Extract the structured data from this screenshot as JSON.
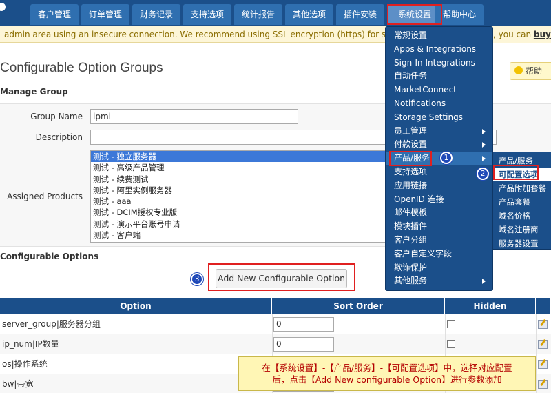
{
  "nav": {
    "tabs": [
      "客户管理",
      "订单管理",
      "财务记录",
      "支持选项",
      "统计报告",
      "其他选项",
      "插件安装",
      "系统设置",
      "帮助中心"
    ],
    "active": "系统设置"
  },
  "warning": {
    "text": "admin area using an insecure connection. We recommend using SSL encryption (https) for security. If you c",
    "tail_text": ", you can ",
    "tail_link": "buy o"
  },
  "page": {
    "title": "Configurable Option Groups",
    "help_label": "帮助"
  },
  "manage_group": {
    "heading": "Manage Group",
    "group_name_label": "Group Name",
    "group_name_value": "ipmi",
    "description_label": "Description",
    "description_value": "",
    "assigned_products_label": "Assigned Products",
    "products": [
      "测试 - 独立服务器",
      "测试 - 高级产品管理",
      "测试 - 续费测试",
      "测试 - 阿里实例服务器",
      "测试 - aaa",
      "测试 - DCIM授权专业版",
      "测试 - 演示平台账号申请",
      "测试 - 客户端"
    ],
    "selected_product": "测试 - 独立服务器"
  },
  "configurable_options": {
    "heading": "Configurable Options",
    "add_button_label": "Add New Configurable Option",
    "columns": [
      "Option",
      "Sort Order",
      "Hidden"
    ],
    "rows": [
      {
        "name": "server_group|服务器分组",
        "sort": "0",
        "hidden": false
      },
      {
        "name": "ip_num|IP数量",
        "sort": "0",
        "hidden": false
      },
      {
        "name": "os|操作系统",
        "sort": "",
        "hidden": false
      },
      {
        "name": "bw|带宽",
        "sort": "",
        "hidden": false
      }
    ]
  },
  "system_menu": {
    "items": [
      {
        "label": "常规设置",
        "submenu": false
      },
      {
        "label": "Apps & Integrations",
        "submenu": false
      },
      {
        "label": "Sign-In Integrations",
        "submenu": false
      },
      {
        "label": "自动任务",
        "submenu": false
      },
      {
        "label": "MarketConnect",
        "submenu": false
      },
      {
        "label": "Notifications",
        "submenu": false
      },
      {
        "label": "Storage Settings",
        "submenu": false
      },
      {
        "label": "员工管理",
        "submenu": true
      },
      {
        "label": "付款设置",
        "submenu": true
      },
      {
        "label": "产品/服务",
        "submenu": true
      },
      {
        "label": "支持选项",
        "submenu": true
      },
      {
        "label": "应用链接",
        "submenu": false
      },
      {
        "label": "OpenID 连接",
        "submenu": false
      },
      {
        "label": "邮件模板",
        "submenu": false
      },
      {
        "label": "模块插件",
        "submenu": false
      },
      {
        "label": "客户分组",
        "submenu": false
      },
      {
        "label": "客户自定义字段",
        "submenu": false
      },
      {
        "label": "欺诈保护",
        "submenu": false
      },
      {
        "label": "其他服务",
        "submenu": true
      }
    ],
    "hovered": "产品/服务"
  },
  "products_submenu": {
    "items": [
      "产品/服务",
      "可配置选项",
      "产品附加套餐",
      "产品套餐",
      "域名价格",
      "域名注册商",
      "服务器设置"
    ],
    "active": "可配置选项"
  },
  "steps": [
    "1",
    "2",
    "3"
  ],
  "note": {
    "line1": "在【系统设置】-【产品/服务】-【可配置选项】中，选择对应配置",
    "line2": "后，点击【Add New configurable Option】进行参数添加"
  },
  "colors": {
    "nav_bg": "#1b4f8a",
    "highlight": "#e02020",
    "note_text": "#b40000",
    "step_circle": "#1f49b8"
  }
}
